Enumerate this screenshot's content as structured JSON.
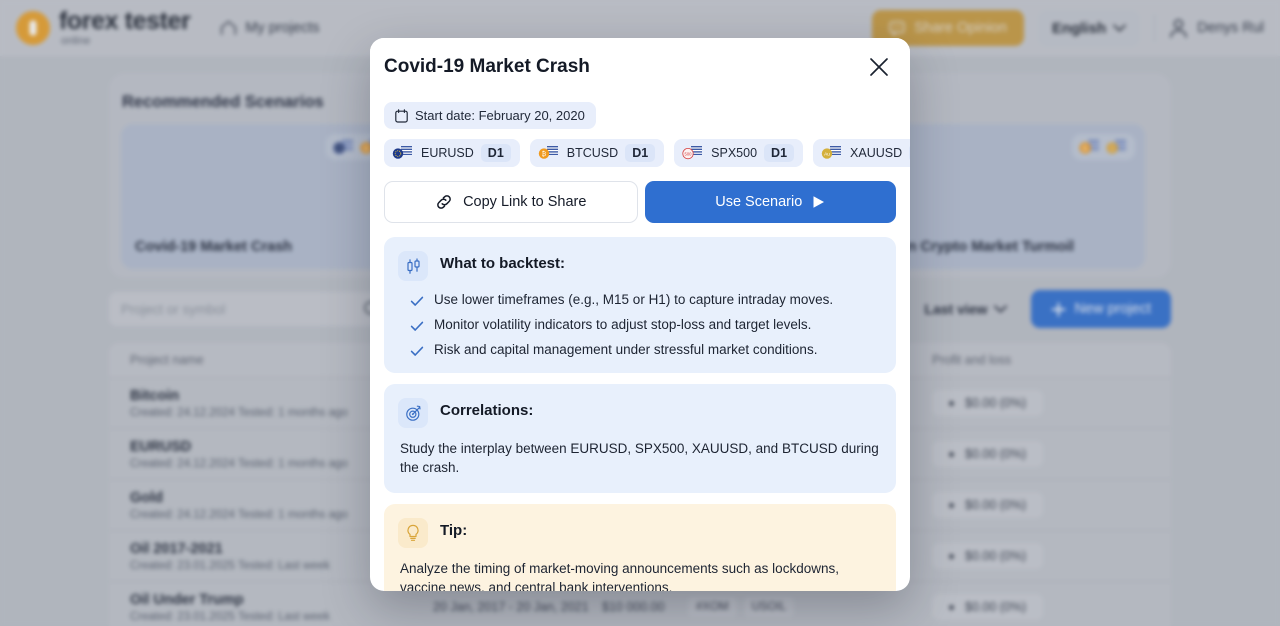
{
  "header": {
    "brand_title": "forex tester",
    "brand_sub": "online",
    "nav_my_projects": "My projects",
    "share_opinion": "Share Opinion",
    "language": "English",
    "user_name": "Denys Rul"
  },
  "recommended": {
    "title": "Recommended Scenarios",
    "cards": [
      {
        "name": "Covid-19 Market Crash",
        "pairs": [
          "EURUSD",
          "BTCUSD",
          "SPX500",
          "XAUUSD"
        ]
      },
      {
        "name": "",
        "pairs": []
      },
      {
        "name": "Retail-Driven Crypto Market Turmoil",
        "pairs": [
          "BTCUSD",
          "ETHUSD"
        ]
      }
    ]
  },
  "toolbar": {
    "search_placeholder": "Project or symbol",
    "search_value": "",
    "sort_label": "Last view",
    "new_project_label": "New project"
  },
  "table": {
    "columns": [
      "Project name",
      "",
      "",
      "",
      "Profit and loss"
    ],
    "rows": [
      {
        "name": "Bitcoin",
        "meta": "Created: 24.12.2024 Tested: 1 months ago",
        "range": "",
        "deposit": "",
        "tags": [],
        "pl": "$0.00 (0%)"
      },
      {
        "name": "EURUSD",
        "meta": "Created: 24.12.2024 Tested: 1 months ago",
        "range": "",
        "deposit": "",
        "tags": [],
        "pl": "$0.00 (0%)"
      },
      {
        "name": "Gold",
        "meta": "Created: 24.12.2024 Tested: 1 months ago",
        "range": "",
        "deposit": "",
        "tags": [],
        "pl": "$0.00 (0%)"
      },
      {
        "name": "Oil 2017-2021",
        "meta": "Created: 23.01.2025 Tested: Last week",
        "range": "",
        "deposit": "",
        "tags": [],
        "pl": "$0.00 (0%)"
      },
      {
        "name": "Oil Under Trump",
        "meta": "Created: 23.01.2025 Tested: Last week",
        "range": "20 Jan, 2017 - 20 Jan, 2021",
        "deposit": "$10 000.00",
        "tags": [
          "#XOM",
          "USOIL"
        ],
        "pl": "$0.00 (0%)"
      }
    ]
  },
  "modal": {
    "title": "Covid-19 Market Crash",
    "close_label": "Close",
    "start_date": "Start date: February 20, 2020",
    "symbols": [
      {
        "symbol": "EURUSD",
        "timeframe": "D1"
      },
      {
        "symbol": "BTCUSD",
        "timeframe": "D1"
      },
      {
        "symbol": "SPX500",
        "timeframe": "D1"
      },
      {
        "symbol": "XAUUSD",
        "timeframe": "D1"
      }
    ],
    "copy_link_label": "Copy Link to Share",
    "use_scenario_label": "Use Scenario",
    "backtest": {
      "title": "What to backtest:",
      "items": [
        "Use lower timeframes (e.g., M15 or H1) to capture intraday moves.",
        "Monitor volatility indicators to adjust stop-loss and target levels.",
        "Risk and capital management under stressful market conditions."
      ]
    },
    "correlations": {
      "title": "Correlations:",
      "text": "Study the interplay between EURUSD, SPX500, XAUUSD, and BTCUSD during the crash."
    },
    "tip": {
      "title": "Tip:",
      "text": "Analyze the timing of market-moving announcements such as lockdowns, vaccine news, and central bank interventions."
    }
  },
  "colors": {
    "accent_blue": "#2f6fd0",
    "brand_orange": "#e8a02a",
    "share_gold": "#c79a3f",
    "info_blue_bg": "#e8f0fc",
    "info_cream_bg": "#fdf3e0"
  }
}
